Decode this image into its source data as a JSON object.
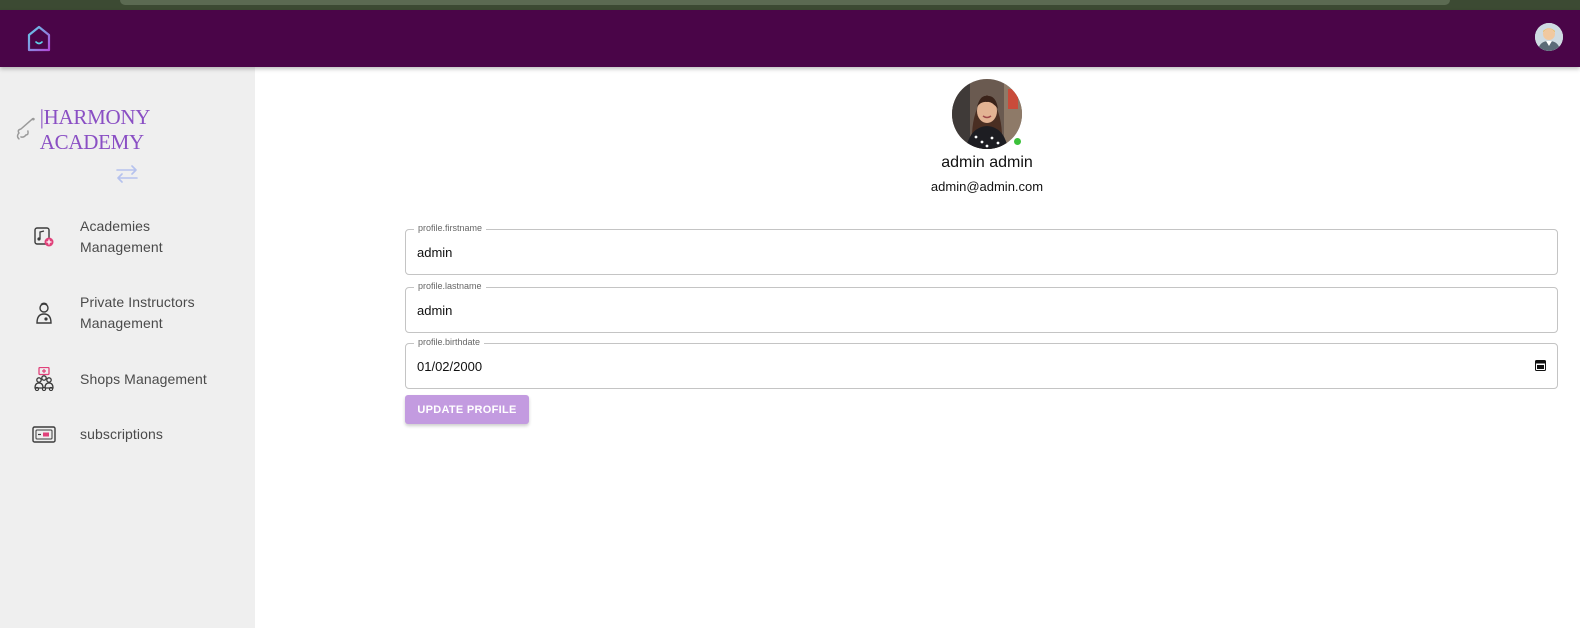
{
  "topbar": {
    "logo_icon": "house-logo-icon",
    "user_avatar_icon": "user-avatar-icon",
    "background": "#4a0548"
  },
  "sidebar": {
    "brand_text": "|HARMONY ACADEMY",
    "brand_color": "#8a4fc4",
    "toggle_icon": "swap-arrows-icon",
    "items": [
      {
        "label_line1": "Academies",
        "label_line2": "Management",
        "icon": "academy-icon"
      },
      {
        "label_line1": "Private Instructors",
        "label_line2": "Management",
        "icon": "instructor-icon"
      },
      {
        "label_line1": "Shops Management",
        "label_line2": "",
        "icon": "shops-icon"
      },
      {
        "label_line1": "subscriptions",
        "label_line2": "",
        "icon": "subscriptions-icon"
      }
    ]
  },
  "profile": {
    "name": "admin admin",
    "email": "admin@admin.com",
    "status": "online",
    "status_color": "#3cc13b"
  },
  "form": {
    "firstname": {
      "label": "profile.firstname",
      "value": "admin"
    },
    "lastname": {
      "label": "profile.lastname",
      "value": "admin"
    },
    "birthdate": {
      "label": "profile.birthdate",
      "value": "01/02/2000"
    },
    "submit_label": "UPDATE PROFILE",
    "submit_color": "#c39be0"
  }
}
